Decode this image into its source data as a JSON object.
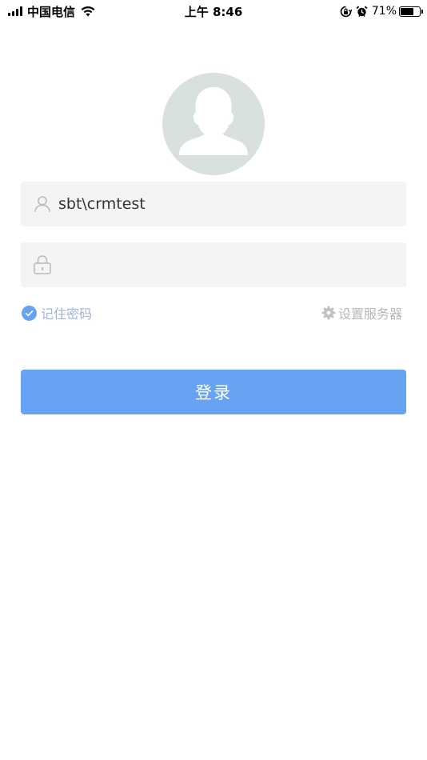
{
  "status_bar": {
    "carrier": "中国电信",
    "time": "上午 8:46",
    "battery_percent": "71%",
    "battery_level": 0.71,
    "icons": [
      "signal-icon",
      "wifi-icon",
      "orientation-lock-icon",
      "alarm-icon",
      "battery-icon"
    ]
  },
  "login": {
    "avatar_icon": "user-silhouette-icon",
    "username": {
      "value": "sbt\\crmtest",
      "icon": "user-icon"
    },
    "password": {
      "value": "",
      "icon": "lock-icon"
    },
    "remember": {
      "label": "记住密码",
      "checked": true,
      "icon": "check-circle-icon"
    },
    "server_settings": {
      "label": "设置服务器",
      "icon": "gear-icon"
    },
    "submit_label": "登录"
  },
  "colors": {
    "primary": "#68a3f3",
    "input_bg": "#f3f4f6",
    "avatar_bg": "#d9e0e0",
    "remember_text": "#9fb4d6",
    "muted_text": "#b8b8b8"
  }
}
